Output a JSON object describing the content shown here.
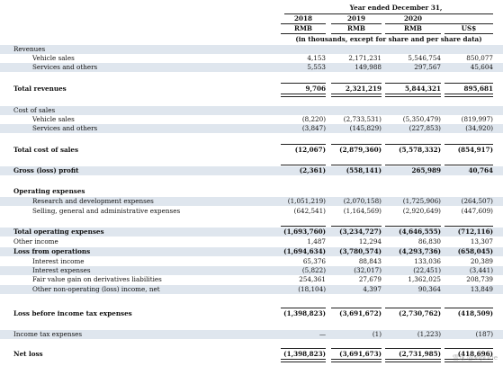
{
  "header": {
    "period": "Year ended December 31,",
    "years": [
      "2018",
      "2019",
      "2020",
      ""
    ],
    "currencies": [
      "RMB",
      "RMB",
      "RMB",
      "US$"
    ],
    "units": "(in thousands, except for share and per share data)"
  },
  "rows": [
    {
      "label": "Revenues",
      "values": [
        "",
        "",
        "",
        ""
      ]
    },
    {
      "label": "Vehicle sales",
      "values": [
        "4,153",
        "2,171,231",
        "5,546,754",
        "850,077"
      ]
    },
    {
      "label": "Services and others",
      "values": [
        "5,553",
        "149,988",
        "297,567",
        "45,604"
      ]
    },
    {
      "label": "Total revenues",
      "values": [
        "9,706",
        "2,321,219",
        "5,844,321",
        "895,681"
      ]
    },
    {
      "label": "Cost of sales",
      "values": [
        "",
        "",
        "",
        ""
      ]
    },
    {
      "label": "Vehicle sales",
      "values": [
        "(8,220)",
        "(2,733,531)",
        "(5,350,479)",
        "(819,997)"
      ]
    },
    {
      "label": "Services and others",
      "values": [
        "(3,847)",
        "(145,829)",
        "(227,853)",
        "(34,920)"
      ]
    },
    {
      "label": "Total cost of sales",
      "values": [
        "(12,067)",
        "(2,879,360)",
        "(5,578,332)",
        "(854,917)"
      ]
    },
    {
      "label": "Gross (loss) profit",
      "values": [
        "(2,361)",
        "(558,141)",
        "265,989",
        "40,764"
      ]
    },
    {
      "label": "Operating expenses",
      "values": [
        "",
        "",
        "",
        ""
      ]
    },
    {
      "label": "Research and development expenses",
      "values": [
        "(1,051,219)",
        "(2,070,158)",
        "(1,725,906)",
        "(264,507)"
      ]
    },
    {
      "label": "Selling, general and administrative expenses",
      "values": [
        "(642,541)",
        "(1,164,569)",
        "(2,920,649)",
        "(447,609)"
      ]
    },
    {
      "label": "Total operating expenses",
      "values": [
        "(1,693,760)",
        "(3,234,727)",
        "(4,646,555)",
        "(712,116)"
      ]
    },
    {
      "label": "Other income",
      "values": [
        "1,487",
        "12,294",
        "86,830",
        "13,307"
      ]
    },
    {
      "label": "Loss from operations",
      "values": [
        "(1,694,634)",
        "(3,780,574)",
        "(4,293,736)",
        "(658,045)"
      ]
    },
    {
      "label": "Interest income",
      "values": [
        "65,376",
        "88,843",
        "133,036",
        "20,389"
      ]
    },
    {
      "label": "Interest expenses",
      "values": [
        "(5,822)",
        "(32,017)",
        "(22,451)",
        "(3,441)"
      ]
    },
    {
      "label": "Fair value gain on derivatives liabilities",
      "values": [
        "254,361",
        "27,679",
        "1,362,025",
        "208,739"
      ]
    },
    {
      "label": "Other non-operating (loss) income, net",
      "values": [
        "(18,104)",
        "4,397",
        "90,364",
        "13,849"
      ]
    },
    {
      "label": "Loss before income tax expenses",
      "values": [
        "(1,398,823)",
        "(3,691,672)",
        "(2,730,762)",
        "(418,509)"
      ]
    },
    {
      "label": "Income tax expenses",
      "values": [
        "—",
        "(1)",
        "(1,223)",
        "(187)"
      ]
    },
    {
      "label": "Net loss",
      "values": [
        "(1,398,823)",
        "(3,691,673)",
        "(2,731,985)",
        "(418,696)"
      ]
    }
  ],
  "watermark": "雪球 @TopDDe"
}
